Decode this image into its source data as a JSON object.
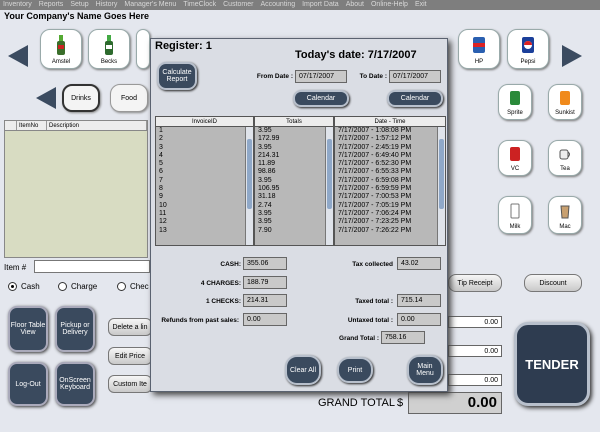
{
  "menubar": [
    "Inventory",
    "Reports",
    "Setup",
    "History",
    "Manager's Menu",
    "TimeClock",
    "Customer",
    "Accounting",
    "Import Data",
    "About",
    "Online-Help",
    "Exit"
  ],
  "company_name": "Your Company's Name Goes Here",
  "products_top": [
    "Amstel",
    "Becks",
    "HP",
    "Pepsi"
  ],
  "categories": [
    "Drinks",
    "Food"
  ],
  "products_right": [
    "Sprite",
    "Sunkist",
    "VC",
    "Tea",
    "Milk",
    "Mac"
  ],
  "item_table": {
    "headers": [
      "ItemNo",
      "Description"
    ]
  },
  "item_label": "Item #",
  "payment": {
    "options": [
      "Cash",
      "Charge",
      "Chec"
    ],
    "selected": "Cash"
  },
  "tip_receipt": "Tip Receipt",
  "discount": "Discount",
  "left_buttons": [
    "Floor Table View",
    "Pickup or Delivery",
    "Log-Out",
    "OnScreen Keyboard"
  ],
  "edit_buttons": [
    "Delete a lin",
    "Edit Price",
    "Custom Ite"
  ],
  "right_values": [
    "0.00",
    "0.00",
    "0.00"
  ],
  "tender": "TENDER",
  "grand_total": {
    "label": "GRAND TOTAL",
    "currency": "$",
    "value": "0.00"
  },
  "dialog": {
    "title": "Register: 1",
    "todays_date_label": "Today's date: 7/17/2007",
    "calculate_report": "Calculate Report",
    "from_label": "From Date :",
    "from_value": "07/17/2007",
    "to_label": "To Date :",
    "to_value": "07/17/2007",
    "calendar_label": "Calendar",
    "columns": [
      "InvoiceID",
      "Totals",
      "Date - Time"
    ],
    "invoice_ids": [
      "1",
      "2",
      "3",
      "4",
      "5",
      "6",
      "7",
      "8",
      "9",
      "10",
      "11",
      "12",
      "13"
    ],
    "totals": [
      "3.95",
      "172.99",
      "3.95",
      "214.31",
      "11.89",
      "98.86",
      "3.95",
      "106.95",
      "31.18",
      "2.74",
      "3.95",
      "3.95",
      "7.90"
    ],
    "datetimes": [
      "7/17/2007 - 1:08:08 PM",
      "7/17/2007 - 1:57:12 PM",
      "7/17/2007 - 2:45:19 PM",
      "7/17/2007 - 6:49:40 PM",
      "7/17/2007 - 6:52:30 PM",
      "7/17/2007 - 6:55:33 PM",
      "7/17/2007 - 6:59:08 PM",
      "7/17/2007 - 6:59:59 PM",
      "7/17/2007 - 7:00:53 PM",
      "7/17/2007 - 7:05:19 PM",
      "7/17/2007 - 7:06:24 PM",
      "7/17/2007 - 7:23:25 PM",
      "7/17/2007 - 7:26:22 PM"
    ],
    "summary_left": [
      {
        "label": "CASH:",
        "value": "355.06"
      },
      {
        "label": "4 CHARGES:",
        "value": "188.79"
      },
      {
        "label": "1 CHECKS:",
        "value": "214.31"
      },
      {
        "label": "Refunds from past sales:",
        "value": "0.00"
      }
    ],
    "summary_right": [
      {
        "label": "Tax collected",
        "value": "43.02"
      },
      {
        "label": "Taxed total :",
        "value": "715.14"
      },
      {
        "label": "Untaxed total :",
        "value": "0.00"
      },
      {
        "label": "Grand Total :",
        "value": "758.16"
      }
    ],
    "buttons": [
      "Clear All",
      "Print",
      "Main Menu"
    ]
  }
}
